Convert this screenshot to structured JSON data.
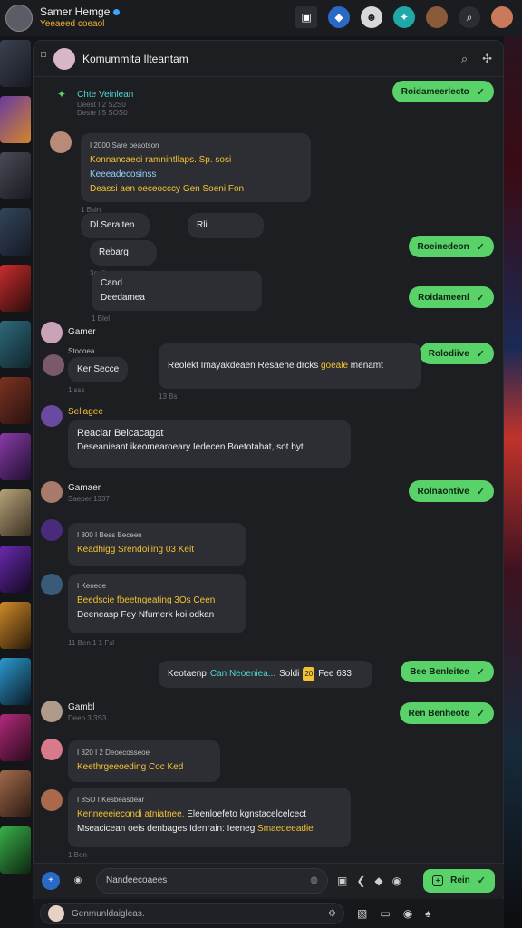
{
  "user": {
    "name": "Samer Hemge",
    "status": "Yeeaeed coeaol"
  },
  "panel": {
    "title": "Komummita Ilteantam"
  },
  "messages": {
    "sent_1": "Roidameerlecto",
    "sys_name": "Chte Veinlean",
    "sys_line1": "Deest I 2 S2S0",
    "sys_line2": "Deste I 5 SOS0",
    "in1_head": "I 2000 Sare beaotson",
    "in1_line1": "Konnancaeoi ramnintllaps. Sp. sosi",
    "in1_line2": "Keeeadecosinss",
    "in1_line3": "Deassi aen oeceocccy Gen Soeni",
    "in1_line3b": "Fon",
    "in1_ts": "1 Bsin",
    "chip1": "Dl Seraiten",
    "chip2": "Rli",
    "in2": "Rebarg",
    "in2_ts": "3ealls",
    "sent_2": "Roeinedeon",
    "card_title": "Cand",
    "card_body": "Deedamea",
    "sent_3": "Roidameenl",
    "card_ts": "1 Blel",
    "gamer_name": "Gamer",
    "in3_name": "Stocoea",
    "in3_body": "Ker Secce",
    "in3_ts": "1 sss",
    "sent_4": "Rolodiive",
    "long_msg_a": "Reolekt Imayakdeaen Resaehe drcks",
    "long_msg_b": "goeale",
    "long_msg_c": "menamt",
    "long_ts": "13 Bs",
    "in4_name": "Sellagee",
    "in4_title": "Reaciar Belcacagat",
    "in4_body": "Deseanieant ikeomearoeary Iedecen Boetotahat, sot byt",
    "in5_name": "Gamaer",
    "in5_sub": "Saeper 1337",
    "sent_5": "Rolnaontive",
    "in6_head": "I 800 I Bess Beceen",
    "in6_body": "Keadhigg Srendoiling 03 Keit",
    "in7_head": "I Keneoe",
    "in7_line1": "Beedscie fbeetngeating 3Os Ceen",
    "in7_line2": "Deeneasp Fey Nfumerk koi odkan",
    "in7_ts": "11 Ben 1 1 Fsl",
    "mid_a": "Keotaenp",
    "mid_b": "Can Neoeniea...",
    "mid_c": "Soldi",
    "mid_badge": "20",
    "mid_d": "Fee 633",
    "sent_6": "Bee Benleitee",
    "sent_7": "Ren Benheote",
    "in8_name": "Gambl",
    "in8_sub": "Deeo 3 3S3",
    "in9_head": "I 820 I 2 Deoecosseoe",
    "in9_body": "Keethrgeeoeding Coc Ked",
    "in10_head": "I 8SO I Kesbeasdear",
    "in10_line1": "Kenneeeiecondi atniatnee.",
    "in10_line1b": "Eleenloefeto kgnstacelcelcect",
    "in10_line2": "Mseacicean oeis denbages Idenrain: Ieeneg",
    "in10_line2b": "Smaedeeadie",
    "in10_ts": "1 Ben"
  },
  "composer": {
    "placeholder": "Nandeecoaees",
    "send_label": "Rein"
  },
  "bottom": {
    "placeholder": "Genmunldaigleas."
  },
  "colors": {
    "accent": "#59d26a",
    "bubble": "#2d2e33",
    "panel": "#1d1e22",
    "highlight": "#f2c233"
  }
}
